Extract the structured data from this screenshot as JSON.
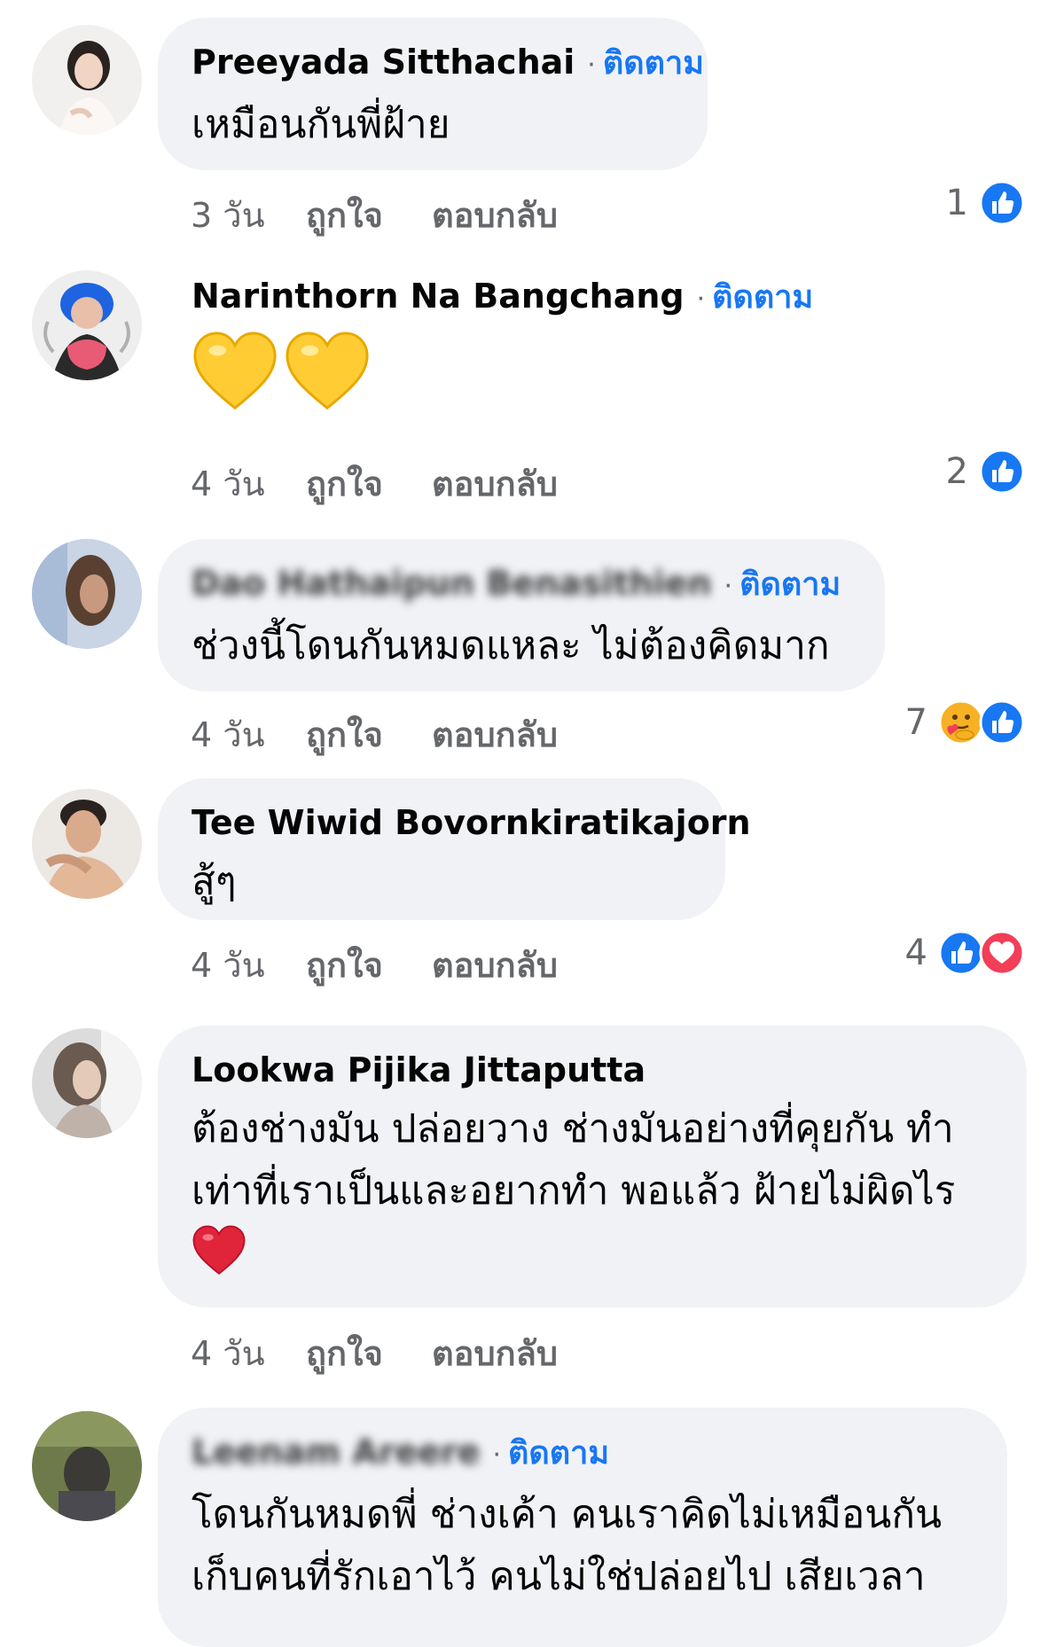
{
  "follow_label": "ติดตาม",
  "colors": {
    "bubble": "#f0f2f5",
    "follow": "#1877f2",
    "meta_text": "#65676b",
    "like": "#1877f2",
    "love": "#f33e58"
  },
  "comments": [
    {
      "author": "Preeyada Sitthachai",
      "show_follow": true,
      "text": "เหมือนกันพี่ฝ้าย",
      "time": "3 วัน",
      "like_label": "ถูกใจ",
      "reply_label": "ตอบกลับ",
      "reaction_count": "1",
      "reactions": [
        "like-icon"
      ]
    },
    {
      "author": "Narinthorn Na Bangchang",
      "show_follow": true,
      "text": "",
      "emoji": [
        "yellow-heart-icon",
        "yellow-heart-icon"
      ],
      "time": "4 วัน",
      "like_label": "ถูกใจ",
      "reply_label": "ตอบกลับ",
      "reaction_count": "2",
      "reactions": [
        "like-icon"
      ]
    },
    {
      "author": "Dao Hathaipun Benasithien",
      "author_blurred": true,
      "show_follow": true,
      "text": "ช่วงนี้โดนกันหมดแหละ ไม่ต้องคิดมาก",
      "time": "4 วัน",
      "like_label": "ถูกใจ",
      "reply_label": "ตอบกลับ",
      "reaction_count": "7",
      "reactions": [
        "care-icon",
        "like-icon"
      ]
    },
    {
      "author": "Tee Wiwid Bovornkiratikajorn",
      "show_follow": false,
      "text": "สู้ๆ",
      "time": "4 วัน",
      "like_label": "ถูกใจ",
      "reply_label": "ตอบกลับ",
      "reaction_count": "4",
      "reactions": [
        "like-icon",
        "love-icon"
      ]
    },
    {
      "author": "Lookwa Pijika Jittaputta",
      "show_follow": false,
      "text_lines": [
        "ต้องช่างมัน ปล่อยวาง ช่างมันอย่างที่คุยกัน ทำ",
        "เท่าที่เราเป็นและอยากทำ พอแล้ว ฝ้ายไม่ผิดไร"
      ],
      "emoji": [
        "red-heart-icon"
      ],
      "time": "4 วัน",
      "like_label": "ถูกใจ",
      "reply_label": "ตอบกลับ"
    },
    {
      "author": "Leenam Areere",
      "author_blurred": true,
      "show_follow": true,
      "text_lines": [
        "โดนกันหมดพี่ ช่างเค้า คนเราคิดไม่เหมือนกัน",
        "เก็บคนที่รักเอาไว้ คนไม่ใช่ปล่อยไป เสียเวลา"
      ]
    }
  ]
}
